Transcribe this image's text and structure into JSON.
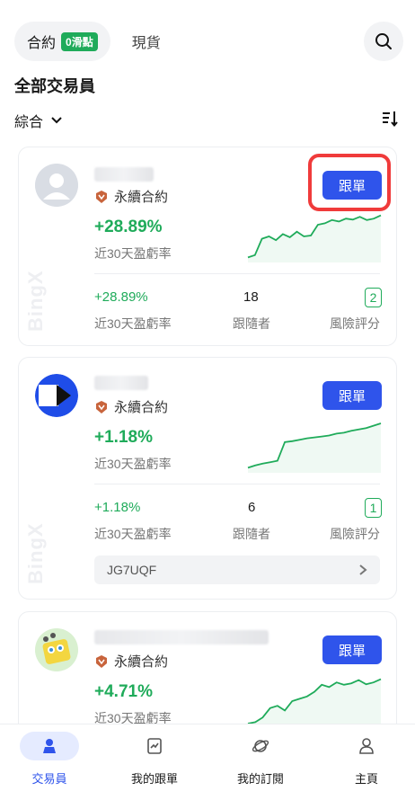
{
  "top_tabs": {
    "active_label": "合約",
    "badge": "0滑點",
    "other_label": "現貨"
  },
  "section_title": "全部交易員",
  "sort": {
    "label": "綜合"
  },
  "labels": {
    "tag": "永續合約",
    "follow": "跟單",
    "roi_label": "近30天盈虧率",
    "followers_label": "跟隨者",
    "risk_label": "風險評分",
    "watermark": "BingX"
  },
  "traders": [
    {
      "roi": "+28.89%",
      "followers": "18",
      "risk": "2",
      "code": null,
      "spark": [
        0.05,
        0.1,
        0.45,
        0.5,
        0.42,
        0.55,
        0.48,
        0.6,
        0.5,
        0.52,
        0.75,
        0.78,
        0.85,
        0.82,
        0.88,
        0.86,
        0.92,
        0.85,
        0.88,
        0.95
      ]
    },
    {
      "roi": "+1.18%",
      "followers": "6",
      "risk": "1",
      "code": "JG7UQF",
      "spark": [
        0.05,
        0.1,
        0.14,
        0.17,
        0.2,
        0.6,
        0.62,
        0.65,
        0.68,
        0.7,
        0.72,
        0.74,
        0.78,
        0.8,
        0.84,
        0.87,
        0.9,
        0.95,
        1.0
      ]
    },
    {
      "roi": "+4.71%",
      "followers": null,
      "risk": null,
      "code": null,
      "spark": [
        0.02,
        0.05,
        0.15,
        0.35,
        0.4,
        0.3,
        0.5,
        0.55,
        0.6,
        0.7,
        0.85,
        0.8,
        0.9,
        0.85,
        0.88,
        0.95,
        0.86,
        0.9,
        0.97
      ]
    }
  ],
  "bottom_nav": [
    {
      "label": "交易員",
      "icon": "trader-icon",
      "active": true
    },
    {
      "label": "我的跟單",
      "icon": "copy-orders-icon",
      "active": false
    },
    {
      "label": "我的訂閱",
      "icon": "subscription-icon",
      "active": false
    },
    {
      "label": "主頁",
      "icon": "profile-icon",
      "active": false
    }
  ],
  "colors": {
    "accent": "#2f54eb",
    "positive": "#1fab5a",
    "highlight": "#f03b3b"
  }
}
